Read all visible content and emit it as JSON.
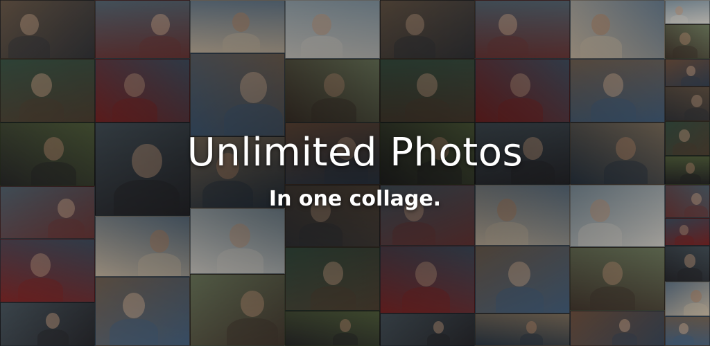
{
  "banner": {
    "headline": "Unlimited Photos",
    "subline": "In one collage.",
    "text_color": "#ffffff"
  },
  "collage": {
    "description_icon": "photo-grid"
  }
}
